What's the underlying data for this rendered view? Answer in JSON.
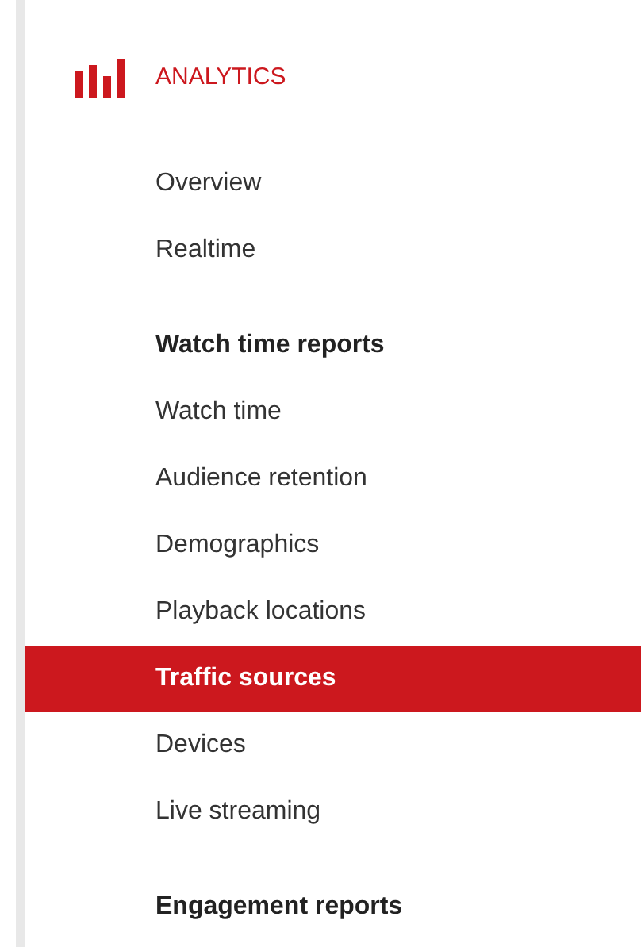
{
  "header": {
    "title": "ANALYTICS"
  },
  "sections": [
    {
      "items": [
        {
          "label": "Overview",
          "kind": "item",
          "selected": false
        },
        {
          "label": "Realtime",
          "kind": "item",
          "selected": false
        }
      ]
    },
    {
      "items": [
        {
          "label": "Watch time reports",
          "kind": "header",
          "selected": false
        },
        {
          "label": "Watch time",
          "kind": "item",
          "selected": false
        },
        {
          "label": "Audience retention",
          "kind": "item",
          "selected": false
        },
        {
          "label": "Demographics",
          "kind": "item",
          "selected": false
        },
        {
          "label": "Playback locations",
          "kind": "item",
          "selected": false
        },
        {
          "label": "Traffic sources",
          "kind": "item",
          "selected": true
        },
        {
          "label": "Devices",
          "kind": "item",
          "selected": false
        },
        {
          "label": "Live streaming",
          "kind": "item",
          "selected": false
        }
      ]
    },
    {
      "items": [
        {
          "label": "Engagement reports",
          "kind": "header",
          "selected": false
        }
      ]
    }
  ]
}
